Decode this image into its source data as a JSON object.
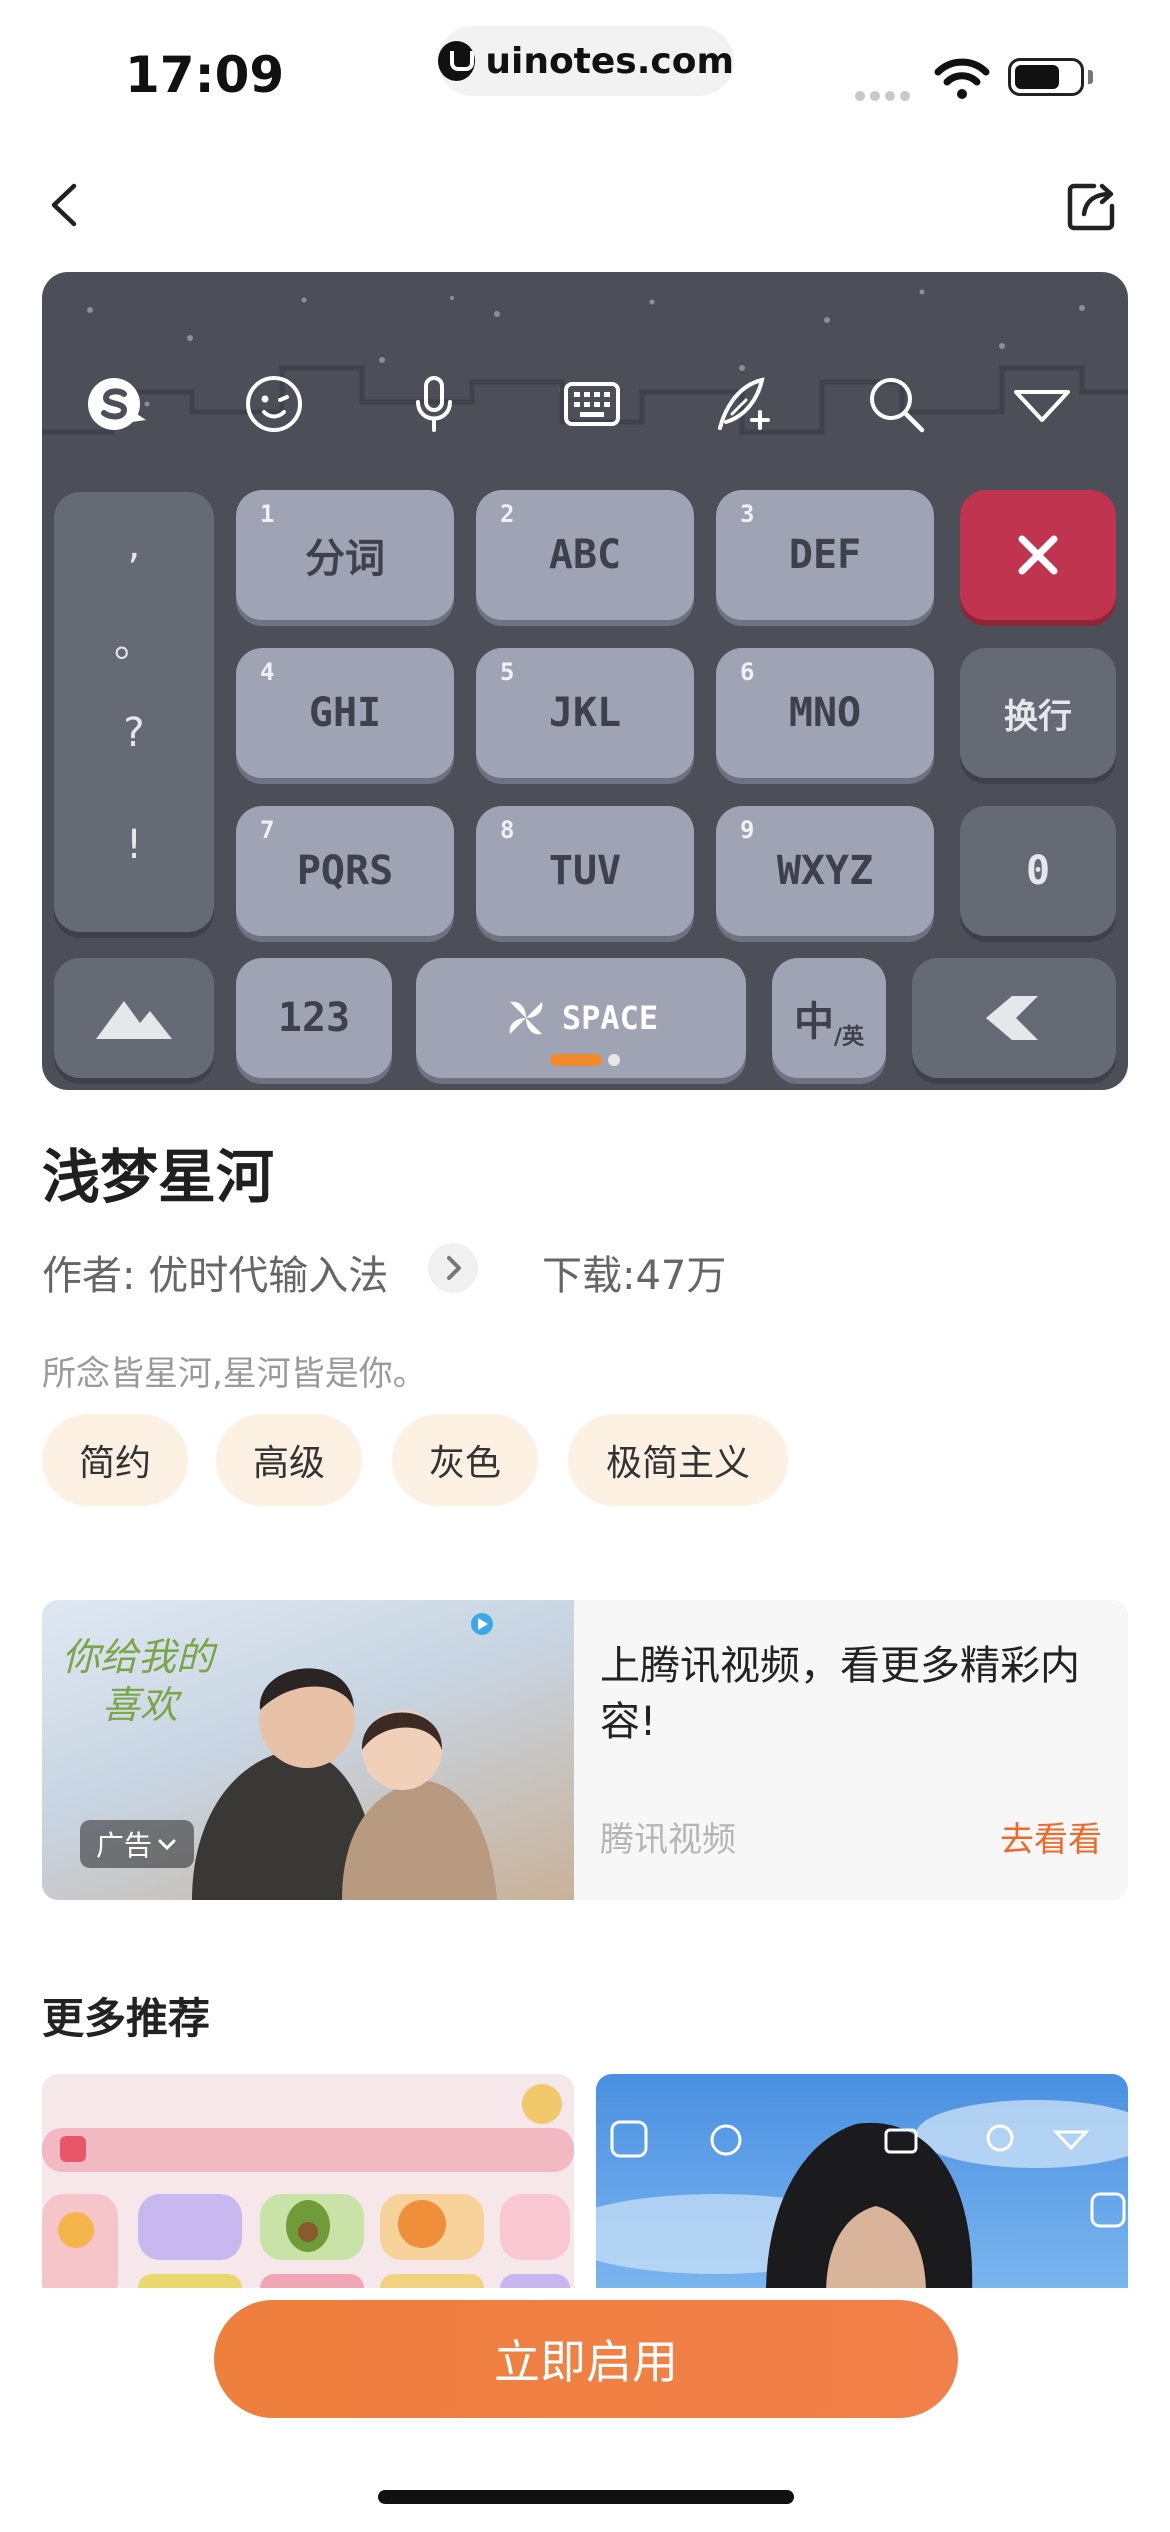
{
  "status_bar": {
    "time": "17:09",
    "url": "uinotes.com"
  },
  "keyboard_preview": {
    "rows": [
      [
        {
          "num": "1",
          "label": "分词"
        },
        {
          "num": "2",
          "label": "ABC"
        },
        {
          "num": "3",
          "label": "DEF"
        }
      ],
      [
        {
          "num": "4",
          "label": "GHI"
        },
        {
          "num": "5",
          "label": "JKL"
        },
        {
          "num": "6",
          "label": "MNO"
        }
      ],
      [
        {
          "num": "7",
          "label": "PQRS"
        },
        {
          "num": "8",
          "label": "TUV"
        },
        {
          "num": "9",
          "label": "WXYZ"
        }
      ]
    ],
    "punctuation": [
      ",",
      "。",
      "?",
      "!"
    ],
    "newline_label": "换行",
    "zero_label": "0",
    "num_label": "123",
    "space_label": "SPACE",
    "lang_main": "中",
    "lang_sub": "/英"
  },
  "skin": {
    "title": "浅梦星河",
    "author": "作者: 优时代输入法",
    "downloads": "下载:47万",
    "description": "所念皆星河,星河皆是你。",
    "tags": [
      "简约",
      "高级",
      "灰色",
      "极简主义"
    ]
  },
  "ad": {
    "badge": "广告",
    "title": "上腾讯视频，看更多精彩内容!",
    "source": "腾讯视频",
    "cta": "去看看"
  },
  "more_section": {
    "title": "更多推荐"
  },
  "cta_button": "立即启用"
}
